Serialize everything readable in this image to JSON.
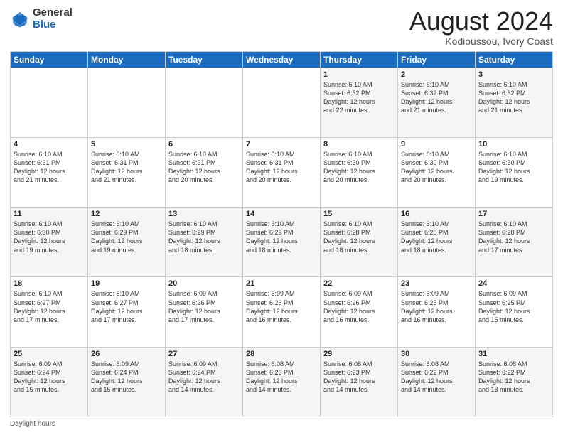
{
  "header": {
    "logo_general": "General",
    "logo_blue": "Blue",
    "title": "August 2024",
    "subtitle": "Kodioussou, Ivory Coast"
  },
  "days_of_week": [
    "Sunday",
    "Monday",
    "Tuesday",
    "Wednesday",
    "Thursday",
    "Friday",
    "Saturday"
  ],
  "weeks": [
    [
      {
        "day": "",
        "info": ""
      },
      {
        "day": "",
        "info": ""
      },
      {
        "day": "",
        "info": ""
      },
      {
        "day": "",
        "info": ""
      },
      {
        "day": "1",
        "info": "Sunrise: 6:10 AM\nSunset: 6:32 PM\nDaylight: 12 hours\nand 22 minutes."
      },
      {
        "day": "2",
        "info": "Sunrise: 6:10 AM\nSunset: 6:32 PM\nDaylight: 12 hours\nand 21 minutes."
      },
      {
        "day": "3",
        "info": "Sunrise: 6:10 AM\nSunset: 6:32 PM\nDaylight: 12 hours\nand 21 minutes."
      }
    ],
    [
      {
        "day": "4",
        "info": "Sunrise: 6:10 AM\nSunset: 6:31 PM\nDaylight: 12 hours\nand 21 minutes."
      },
      {
        "day": "5",
        "info": "Sunrise: 6:10 AM\nSunset: 6:31 PM\nDaylight: 12 hours\nand 21 minutes."
      },
      {
        "day": "6",
        "info": "Sunrise: 6:10 AM\nSunset: 6:31 PM\nDaylight: 12 hours\nand 20 minutes."
      },
      {
        "day": "7",
        "info": "Sunrise: 6:10 AM\nSunset: 6:31 PM\nDaylight: 12 hours\nand 20 minutes."
      },
      {
        "day": "8",
        "info": "Sunrise: 6:10 AM\nSunset: 6:30 PM\nDaylight: 12 hours\nand 20 minutes."
      },
      {
        "day": "9",
        "info": "Sunrise: 6:10 AM\nSunset: 6:30 PM\nDaylight: 12 hours\nand 20 minutes."
      },
      {
        "day": "10",
        "info": "Sunrise: 6:10 AM\nSunset: 6:30 PM\nDaylight: 12 hours\nand 19 minutes."
      }
    ],
    [
      {
        "day": "11",
        "info": "Sunrise: 6:10 AM\nSunset: 6:30 PM\nDaylight: 12 hours\nand 19 minutes."
      },
      {
        "day": "12",
        "info": "Sunrise: 6:10 AM\nSunset: 6:29 PM\nDaylight: 12 hours\nand 19 minutes."
      },
      {
        "day": "13",
        "info": "Sunrise: 6:10 AM\nSunset: 6:29 PM\nDaylight: 12 hours\nand 18 minutes."
      },
      {
        "day": "14",
        "info": "Sunrise: 6:10 AM\nSunset: 6:29 PM\nDaylight: 12 hours\nand 18 minutes."
      },
      {
        "day": "15",
        "info": "Sunrise: 6:10 AM\nSunset: 6:28 PM\nDaylight: 12 hours\nand 18 minutes."
      },
      {
        "day": "16",
        "info": "Sunrise: 6:10 AM\nSunset: 6:28 PM\nDaylight: 12 hours\nand 18 minutes."
      },
      {
        "day": "17",
        "info": "Sunrise: 6:10 AM\nSunset: 6:28 PM\nDaylight: 12 hours\nand 17 minutes."
      }
    ],
    [
      {
        "day": "18",
        "info": "Sunrise: 6:10 AM\nSunset: 6:27 PM\nDaylight: 12 hours\nand 17 minutes."
      },
      {
        "day": "19",
        "info": "Sunrise: 6:10 AM\nSunset: 6:27 PM\nDaylight: 12 hours\nand 17 minutes."
      },
      {
        "day": "20",
        "info": "Sunrise: 6:09 AM\nSunset: 6:26 PM\nDaylight: 12 hours\nand 17 minutes."
      },
      {
        "day": "21",
        "info": "Sunrise: 6:09 AM\nSunset: 6:26 PM\nDaylight: 12 hours\nand 16 minutes."
      },
      {
        "day": "22",
        "info": "Sunrise: 6:09 AM\nSunset: 6:26 PM\nDaylight: 12 hours\nand 16 minutes."
      },
      {
        "day": "23",
        "info": "Sunrise: 6:09 AM\nSunset: 6:25 PM\nDaylight: 12 hours\nand 16 minutes."
      },
      {
        "day": "24",
        "info": "Sunrise: 6:09 AM\nSunset: 6:25 PM\nDaylight: 12 hours\nand 15 minutes."
      }
    ],
    [
      {
        "day": "25",
        "info": "Sunrise: 6:09 AM\nSunset: 6:24 PM\nDaylight: 12 hours\nand 15 minutes."
      },
      {
        "day": "26",
        "info": "Sunrise: 6:09 AM\nSunset: 6:24 PM\nDaylight: 12 hours\nand 15 minutes."
      },
      {
        "day": "27",
        "info": "Sunrise: 6:09 AM\nSunset: 6:24 PM\nDaylight: 12 hours\nand 14 minutes."
      },
      {
        "day": "28",
        "info": "Sunrise: 6:08 AM\nSunset: 6:23 PM\nDaylight: 12 hours\nand 14 minutes."
      },
      {
        "day": "29",
        "info": "Sunrise: 6:08 AM\nSunset: 6:23 PM\nDaylight: 12 hours\nand 14 minutes."
      },
      {
        "day": "30",
        "info": "Sunrise: 6:08 AM\nSunset: 6:22 PM\nDaylight: 12 hours\nand 14 minutes."
      },
      {
        "day": "31",
        "info": "Sunrise: 6:08 AM\nSunset: 6:22 PM\nDaylight: 12 hours\nand 13 minutes."
      }
    ]
  ],
  "footer": {
    "note": "Daylight hours"
  }
}
